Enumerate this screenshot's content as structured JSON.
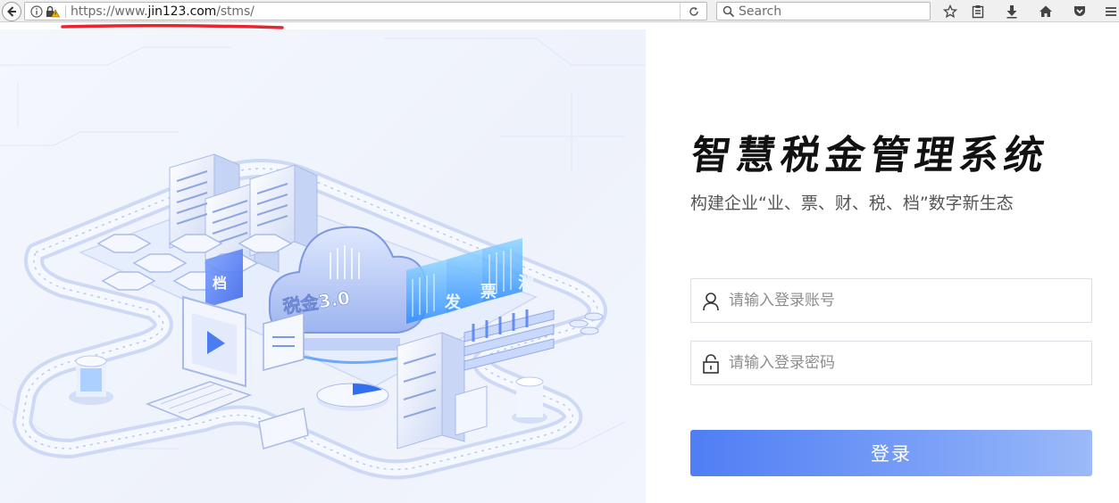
{
  "browser": {
    "url_prefix": "https://www.",
    "url_domain": "jin123.com",
    "url_path": "/stms/",
    "search_placeholder": "Search",
    "annotation_color": "#e8252f"
  },
  "hero": {
    "cloud_text": "税金3.0",
    "card_text_left": "档",
    "card_chars": [
      "发",
      "票",
      "池"
    ]
  },
  "login": {
    "title": "智慧税金管理系统",
    "subtitle": "构建企业“业、票、财、税、档”数字新生态",
    "account_placeholder": "请输入登录账号",
    "password_placeholder": "请输入登录密码",
    "submit_label": "登录",
    "accent_color": "#4f7ef5"
  }
}
